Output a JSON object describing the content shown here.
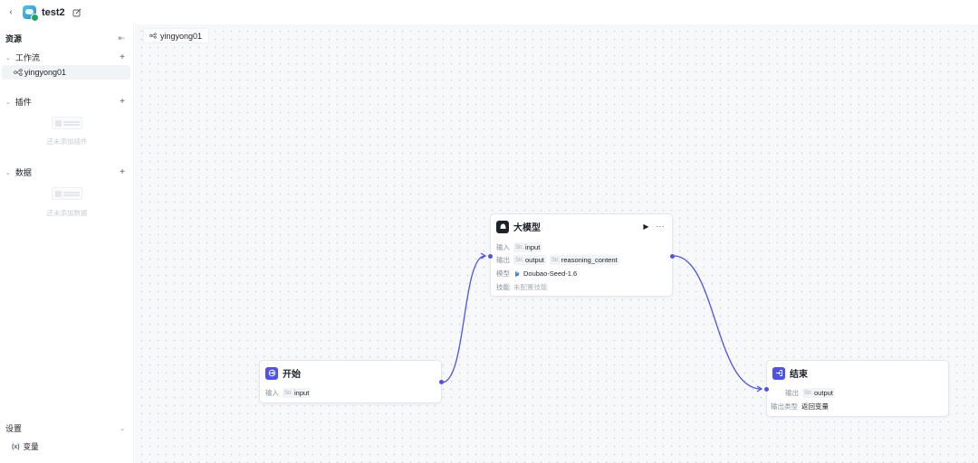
{
  "topbar": {
    "title": "test2"
  },
  "sidebar": {
    "resources_label": "资源",
    "workflow": {
      "label": "工作流",
      "items": [
        {
          "label": "yingyong01"
        }
      ]
    },
    "plugins": {
      "label": "插件",
      "empty_text": "还未添加插件"
    },
    "data": {
      "label": "数据",
      "empty_text": "还未添加数据"
    },
    "settings": {
      "label": "设置",
      "variable_label": "变量",
      "variable_icon": "(x)"
    }
  },
  "canvas": {
    "tab_label": "yingyong01",
    "nodes": {
      "start": {
        "title": "开始",
        "input_label": "输入",
        "input_type": "Str.",
        "input_name": "input"
      },
      "llm": {
        "title": "大模型",
        "input_label": "输入",
        "input_type": "Str.",
        "input_name": "input",
        "output_label": "输出",
        "output_type1": "Str.",
        "output_name1": "output",
        "output_type2": "Str.",
        "output_name2": "reasoning_content",
        "model_label": "模型",
        "model_name": "Doubao-Seed-1.6",
        "skill_label": "技能",
        "skill_value": "未配置技能"
      },
      "end": {
        "title": "结束",
        "output_label": "输出",
        "output_type": "Str.",
        "output_name": "output",
        "output_type_label": "输出类型",
        "output_type_value": "返回变量"
      }
    }
  },
  "colors": {
    "accent": "#4d53e8",
    "canvas_bg": "#f7f8fa",
    "edge": "#4d53e8"
  }
}
